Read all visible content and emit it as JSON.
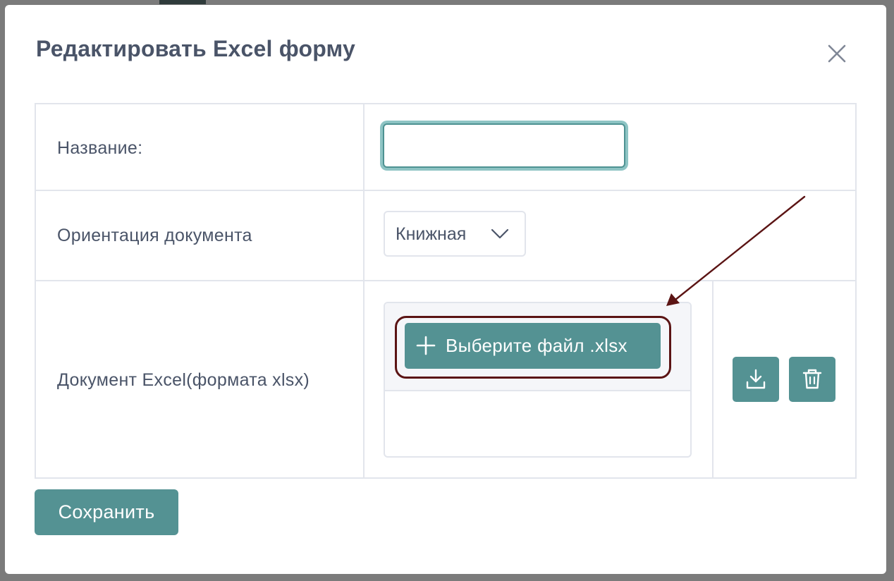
{
  "modal": {
    "title": "Редактировать Excel форму",
    "close_icon": "close-icon"
  },
  "form": {
    "rows": [
      {
        "label": "Название:"
      },
      {
        "label": "Ориентация документа"
      },
      {
        "label": "Документ Excel(формата xlsx)"
      }
    ],
    "name_input": {
      "value": "",
      "placeholder": ""
    },
    "orientation": {
      "selected": "Книжная",
      "icon": "chevron-down-icon"
    },
    "upload": {
      "button_label": "Выберите файл .xlsx",
      "button_icon": "plus-icon"
    },
    "actions": {
      "download_icon": "download-icon",
      "delete_icon": "trash-icon"
    }
  },
  "footer": {
    "save_label": "Сохранить"
  },
  "colors": {
    "accent": "#549293",
    "focus_ring": "#8ec4c4",
    "text": "#4a5468",
    "annotation": "#5b1414"
  }
}
